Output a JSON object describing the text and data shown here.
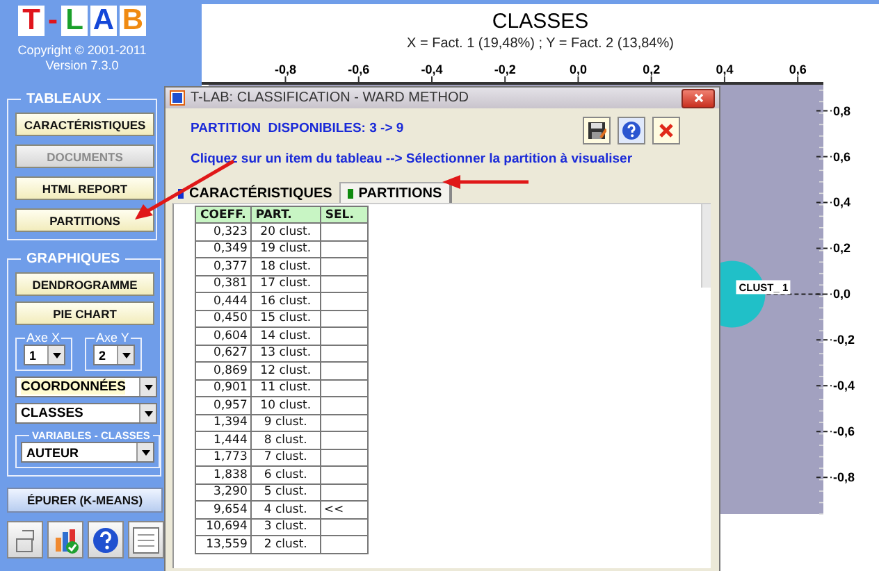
{
  "sidebar": {
    "logo": [
      {
        "letter": "T",
        "color": "#e0141c"
      },
      {
        "letter": "-",
        "color": "#e0141c"
      },
      {
        "letter": "L",
        "color": "#1aa02a"
      },
      {
        "letter": "A",
        "color": "#1447d8"
      },
      {
        "letter": "B",
        "color": "#f08a10"
      }
    ],
    "copyright": "Copyright © 2001-2011",
    "version": "Version 7.3.0",
    "groups": [
      {
        "title": "TABLEAUX",
        "items": [
          {
            "kind": "button",
            "label": "CARACTÉRISTIQUES",
            "disabled": false
          },
          {
            "kind": "button",
            "label": "DOCUMENTS",
            "disabled": true
          },
          {
            "kind": "button",
            "label": "HTML REPORT",
            "disabled": false
          },
          {
            "kind": "button",
            "label": "PARTITIONS",
            "disabled": false
          }
        ]
      },
      {
        "title": "GRAPHIQUES",
        "items": [
          {
            "kind": "button",
            "label": "DENDROGRAMME",
            "disabled": false
          },
          {
            "kind": "button",
            "label": "PIE CHART",
            "disabled": false
          },
          {
            "kind": "axes",
            "axes": [
              {
                "label": "Axe X",
                "value": "1"
              },
              {
                "label": "Axe Y",
                "value": "2"
              }
            ]
          },
          {
            "kind": "dropdown",
            "value": "COORDONNÉES",
            "highlighted": true
          },
          {
            "kind": "dropdown",
            "value": "CLASSES",
            "highlighted": false
          },
          {
            "kind": "subgroup",
            "title": "VARIABLES - CLASSES",
            "value": "AUTEUR"
          }
        ]
      }
    ],
    "action_button": "ÉPURER (K-MEANS)"
  },
  "chart": {
    "title": "CLASSES",
    "subtitle": "X = Fact. 1 (19,48%) ; Y = Fact. 2 (13,84%)",
    "chart_data": {
      "type": "scatter",
      "x": [
        0.42
      ],
      "xlim": [
        -1.01,
        0.67
      ],
      "ylim": [
        -0.96,
        0.92
      ],
      "xticks": [
        {
          "value": -0.8,
          "label": "-0,8"
        },
        {
          "value": -0.6,
          "label": "-0,6"
        },
        {
          "value": -0.4,
          "label": "-0,4"
        },
        {
          "value": -0.2,
          "label": "-0,2"
        },
        {
          "value": 0,
          "label": "0,0"
        },
        {
          "value": 0.2,
          "label": "0,2"
        },
        {
          "value": 0.4,
          "label": "0,4"
        },
        {
          "value": 0.6,
          "label": "0,6"
        }
      ],
      "yticks": [
        {
          "value": 0.8,
          "label": "0,8"
        },
        {
          "value": 0.6,
          "label": "0,6"
        },
        {
          "value": 0.4,
          "label": "0,4"
        },
        {
          "value": 0.2,
          "label": "0,2"
        },
        {
          "value": 0,
          "label": "0,0"
        },
        {
          "value": -0.2,
          "label": "-0,2"
        },
        {
          "value": -0.4,
          "label": "-0,4"
        },
        {
          "value": -0.6,
          "label": "-0,6"
        },
        {
          "value": -0.8,
          "label": "-0,8"
        }
      ],
      "series": [
        {
          "name": "CLUST_ 1",
          "color": "#20c0c8",
          "values": [
            0.0
          ]
        }
      ]
    }
  },
  "dialog": {
    "title": "T-LAB: CLASSIFICATION - WARD METHOD",
    "info": "PARTITION  DISPONIBILES: 3 -> 9",
    "instruction": "Cliquez sur un item du tableau --> Sélectionner la partition à visualiser",
    "tabs": [
      {
        "label": "CARACTÉRISTIQUES",
        "selected": false,
        "color": "#1030d0"
      },
      {
        "label": "PARTITIONS",
        "selected": true,
        "color": "#108a10"
      }
    ],
    "table": {
      "columns": [
        "COEFF.",
        "PART.",
        "SEL."
      ],
      "rows": [
        {
          "coeff": "0,323",
          "part": "20 clust."
        },
        {
          "coeff": "0,349",
          "part": "19 clust."
        },
        {
          "coeff": "0,377",
          "part": "18 clust."
        },
        {
          "coeff": "0,381",
          "part": "17 clust."
        },
        {
          "coeff": "0,444",
          "part": "16 clust."
        },
        {
          "coeff": "0,450",
          "part": "15 clust."
        },
        {
          "coeff": "0,604",
          "part": "14 clust."
        },
        {
          "coeff": "0,627",
          "part": "13 clust."
        },
        {
          "coeff": "0,869",
          "part": "12 clust."
        },
        {
          "coeff": "0,901",
          "part": "11 clust."
        },
        {
          "coeff": "0,957",
          "part": "10 clust."
        },
        {
          "coeff": "1,394",
          "part": "9 clust."
        },
        {
          "coeff": "1,444",
          "part": "8 clust."
        },
        {
          "coeff": "1,773",
          "part": "7 clust."
        },
        {
          "coeff": "1,838",
          "part": "6 clust."
        },
        {
          "coeff": "3,290",
          "part": "5 clust."
        },
        {
          "coeff": "9,654",
          "part": "4 clust.",
          "sel": "<<"
        },
        {
          "coeff": "10,694",
          "part": "3 clust."
        },
        {
          "coeff": "13,559",
          "part": "2 clust."
        }
      ]
    }
  }
}
